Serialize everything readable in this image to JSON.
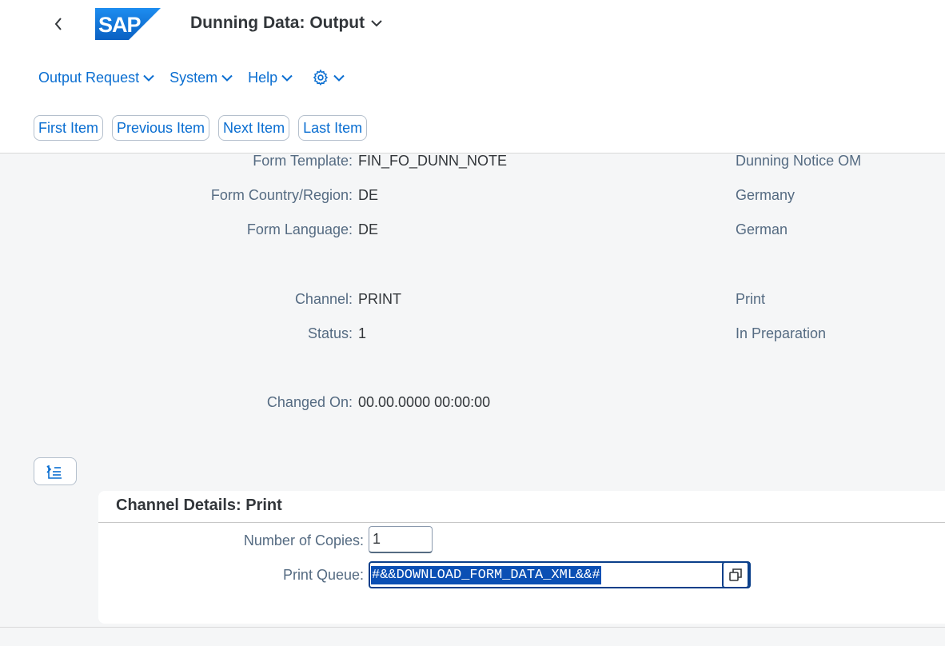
{
  "header": {
    "logo_text": "SAP",
    "app_title": "Dunning Data: Output"
  },
  "menu": [
    {
      "label": "Output Request"
    },
    {
      "label": "System"
    },
    {
      "label": "Help"
    }
  ],
  "toolbar": {
    "first_item": "First Item",
    "previous_item": "Previous Item",
    "next_item": "Next Item",
    "last_item": "Last Item"
  },
  "fields": {
    "form_template": {
      "label": "Form Template:",
      "value": "FIN_FO_DUNN_NOTE",
      "desc": "Dunning Notice OM"
    },
    "form_country": {
      "label": "Form Country/Region:",
      "value": "DE",
      "desc": "Germany"
    },
    "form_language": {
      "label": "Form Language:",
      "value": "DE",
      "desc": "German"
    },
    "channel": {
      "label": "Channel:",
      "value": "PRINT",
      "desc": "Print"
    },
    "status": {
      "label": "Status:",
      "value": "1",
      "desc": "In Preparation"
    },
    "changed_on": {
      "label": "Changed On:",
      "value": "00.00.0000 00:00:00"
    }
  },
  "channel_details": {
    "title": "Channel Details: Print",
    "copies_label": "Number of Copies:",
    "copies_value": "1",
    "queue_label": "Print Queue:",
    "queue_value": "#&&DOWNLOAD_FORM_DATA_XML&&#"
  },
  "icons": {
    "back": "chevron-left-icon",
    "settings": "gear-icon",
    "toggle": "collapse-panel-icon",
    "value_help": "value-help-icon"
  },
  "colors": {
    "accent": "#0a6ed1",
    "selection": "#0a4fb4",
    "focus_border": "#0a3f8a"
  }
}
